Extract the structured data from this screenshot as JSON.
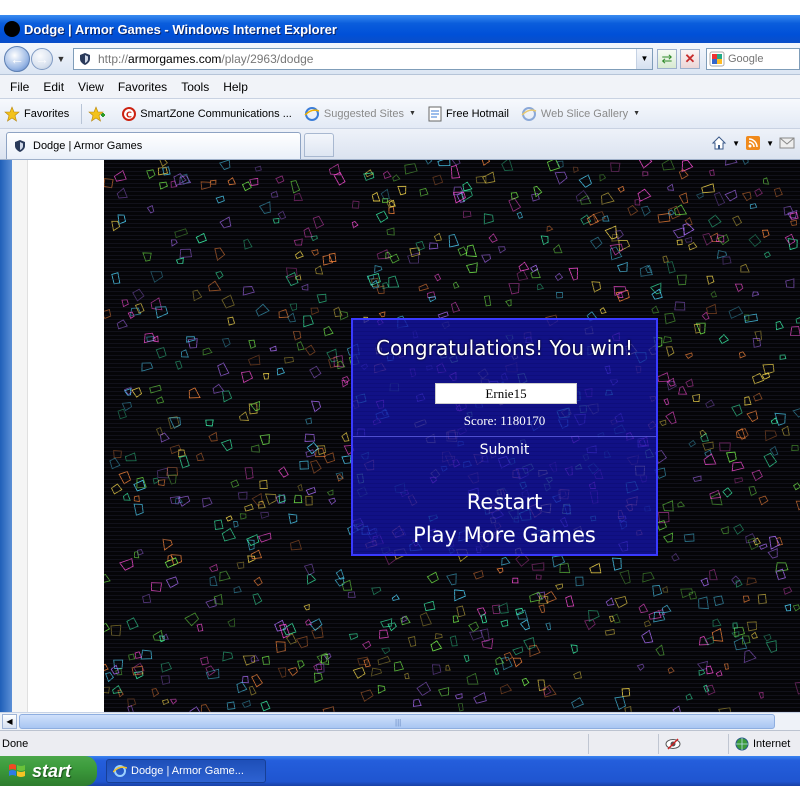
{
  "window": {
    "title": "Dodge | Armor Games - Windows Internet Explorer"
  },
  "address": {
    "url_scheme": "http://",
    "url_host": "armorgames.com",
    "url_path": "/play/2963/dodge",
    "search_placeholder": "Google"
  },
  "menu": [
    "File",
    "Edit",
    "View",
    "Favorites",
    "Tools",
    "Help"
  ],
  "favorites_bar": {
    "favorites_label": "Favorites",
    "items": [
      {
        "label": "SmartZone Communications ...",
        "icon": "smartzone-icon"
      },
      {
        "label": "Suggested Sites",
        "icon": "ie-icon"
      },
      {
        "label": "Free Hotmail",
        "icon": "hotmail-icon"
      },
      {
        "label": "Web Slice Gallery",
        "icon": "webslice-icon"
      }
    ]
  },
  "tab": {
    "label": "Dodge | Armor Games"
  },
  "game_dialog": {
    "title": "Congratulations! You win!",
    "name_value": "Ernie15",
    "score_text": "Score: 1180170",
    "submit_label": "Submit",
    "restart_label": "Restart",
    "more_label": "Play More Games",
    "panel_color": "#1414aa",
    "border_color": "#3a3aff"
  },
  "statusbar": {
    "status": "Done",
    "zone": "Internet"
  },
  "taskbar": {
    "start_label": "start",
    "task_label": "Dodge | Armor Game..."
  }
}
